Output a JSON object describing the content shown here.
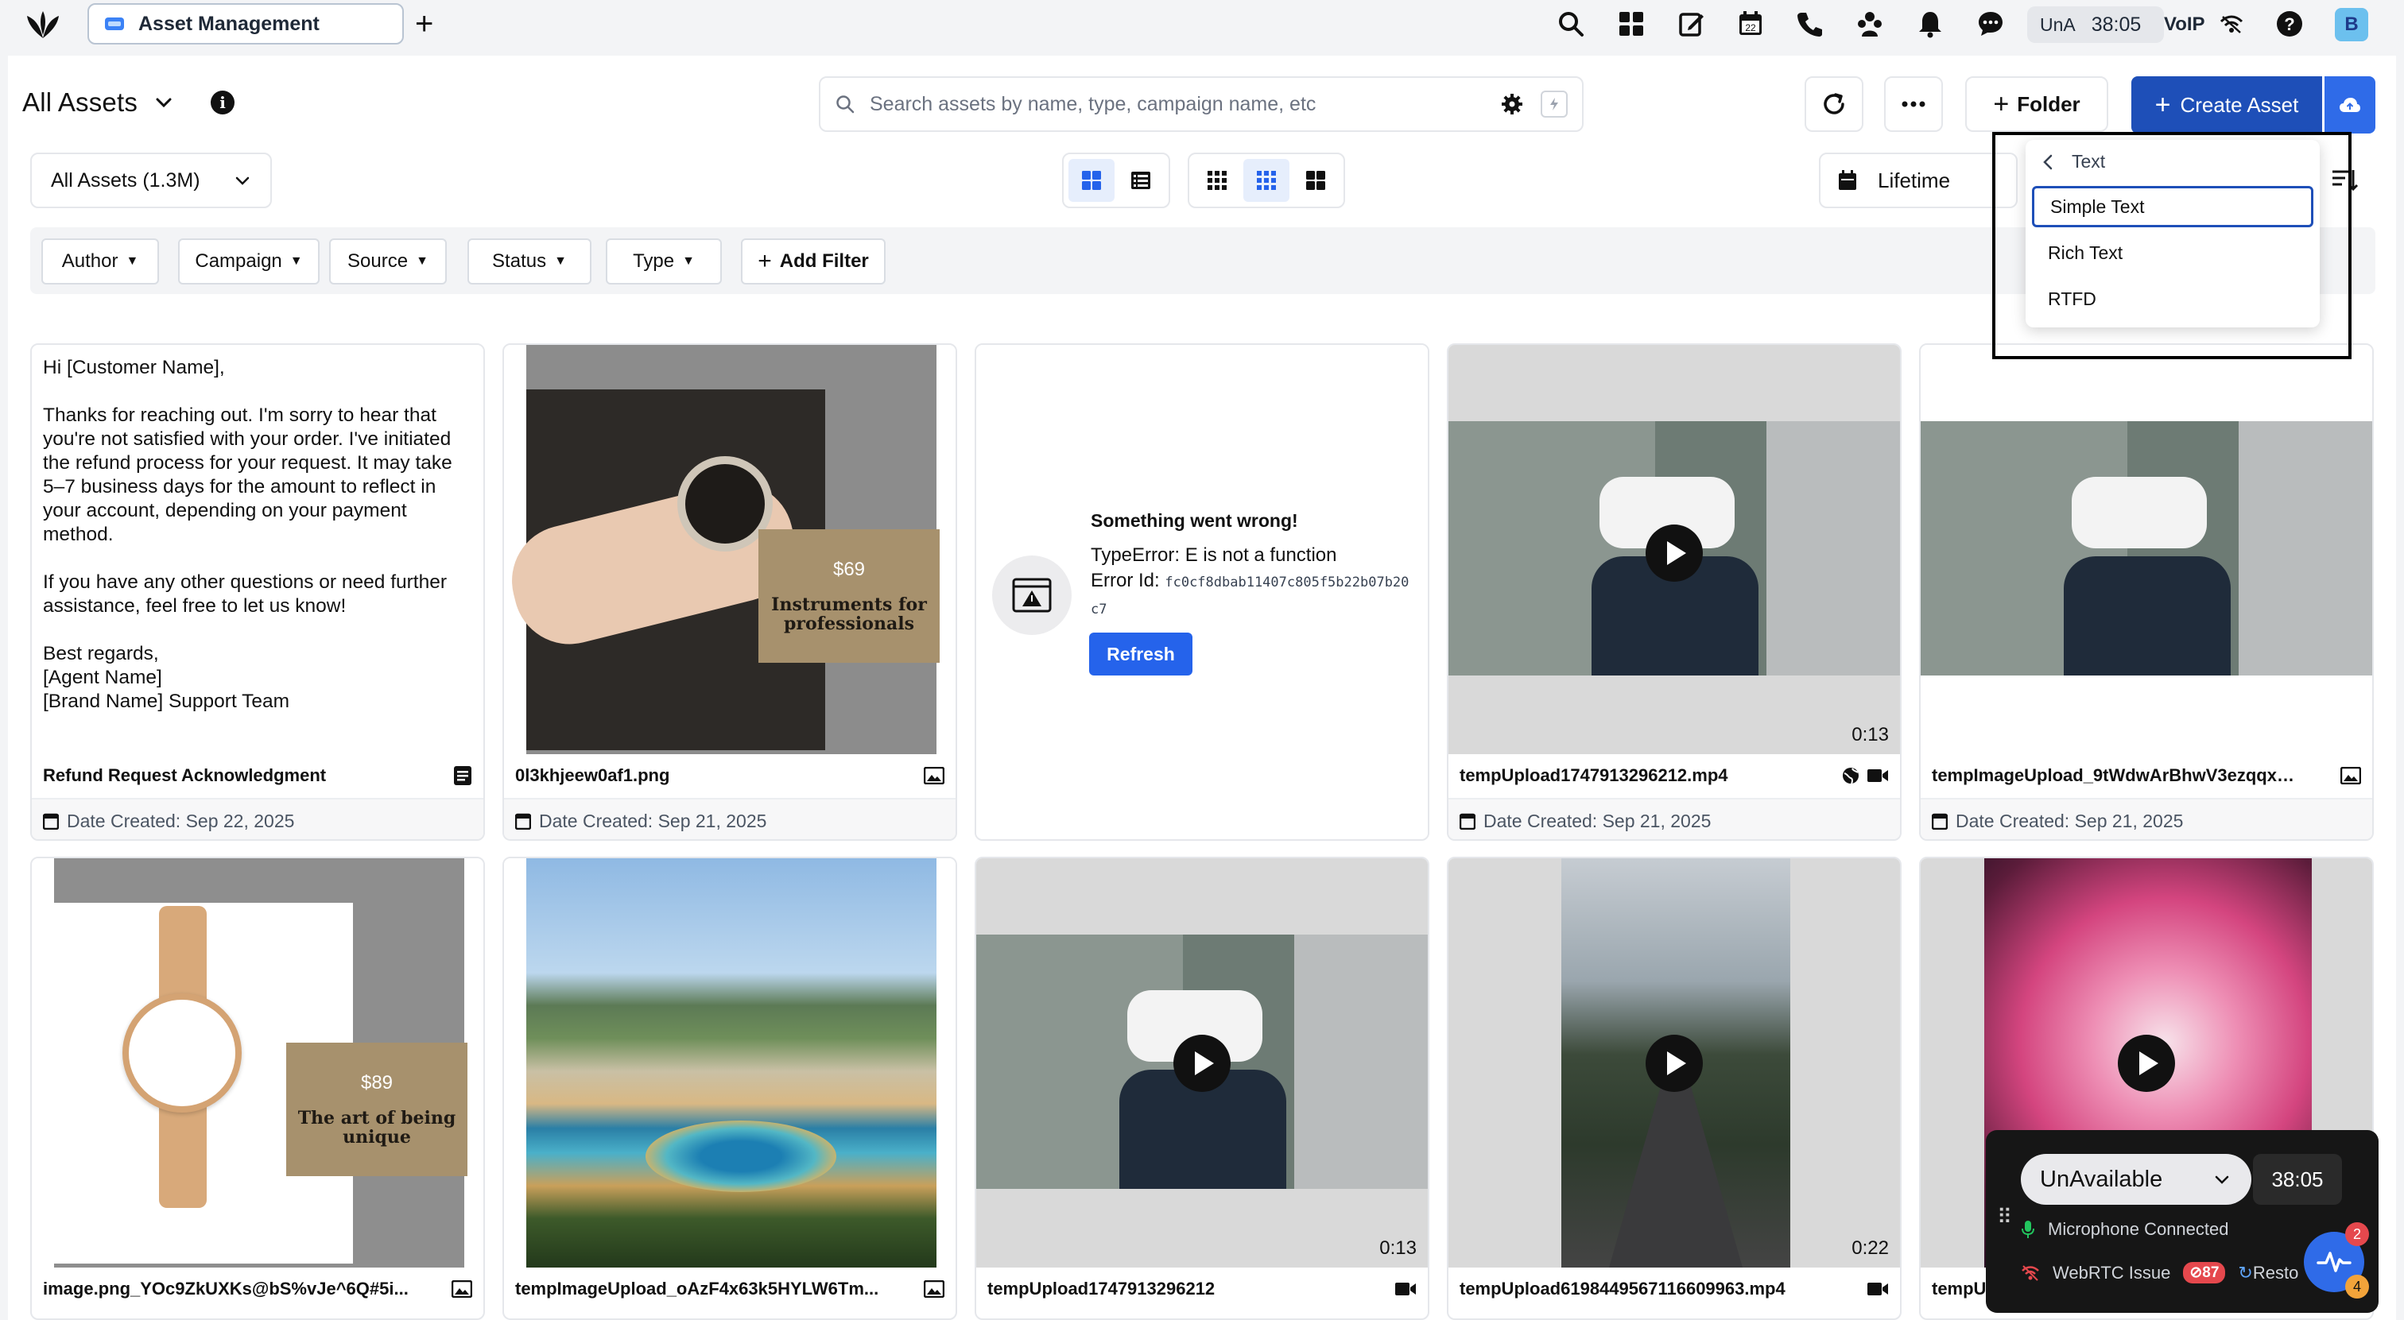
{
  "app": {
    "tab_title": "Asset Management"
  },
  "topbar": {
    "una_label": "UnA",
    "timer": "38:05",
    "voip_label": "VoIP",
    "calendar_day": "22",
    "avatar_initial": "B",
    "icons": [
      "search-icon",
      "apps-grid-icon",
      "compose-icon",
      "calendar-icon",
      "phone-icon",
      "group-icon",
      "bell-icon",
      "chat-icon",
      "wifi-icon",
      "help-icon"
    ]
  },
  "header": {
    "title": "All Assets",
    "search_placeholder": "Search assets by name, type, campaign name, etc",
    "folder_label": "Folder",
    "create_label": "Create Asset"
  },
  "filters": {
    "scope": "All Assets (1.3M)",
    "date_range": "Lifetime",
    "chips": [
      "Author",
      "Campaign",
      "Source",
      "Status",
      "Type"
    ],
    "add_filter": "Add Filter"
  },
  "dropdown": {
    "back_label": "Text",
    "items": [
      "Simple Text",
      "Rich Text",
      "RTFD"
    ],
    "selected": "Simple Text"
  },
  "cards": [
    {
      "kind": "text",
      "body": "Hi [Customer Name],\n\nThanks for reaching out. I'm sorry to hear that you're not satisfied with your order. I've initiated the refund process for your request. It may take 5–7 business days for the amount to reflect in your account, depending on your payment method.\n\nIf you have any other questions or need further assistance, feel free to let us know!\n\nBest regards,\n[Agent Name]\n[Brand Name] Support Team",
      "name": "Refund Request Acknowledgment",
      "date": "Date Created: Sep 22, 2025"
    },
    {
      "kind": "image",
      "price": "$69",
      "tagline": "Instruments for professionals",
      "name": "0l3khjeew0af1.png",
      "date": "Date Created: Sep 21, 2025"
    },
    {
      "kind": "error",
      "title": "Something went wrong!",
      "message": "TypeError: E is not a function",
      "error_label": "Error Id:",
      "error_id": "fc0cf8dbab11407c805f5b22b07b20c7",
      "button": "Refresh"
    },
    {
      "kind": "video",
      "duration": "0:13",
      "name": "tempUpload1747913296212.mp4",
      "date": "Date Created: Sep 21, 2025"
    },
    {
      "kind": "image",
      "name": "tempImageUpload_9tWdwArBhwV3ezqqxS...",
      "date": "Date Created: Sep 21, 2025"
    },
    {
      "kind": "image",
      "price": "$89",
      "tagline": "The art of being unique",
      "name": "image.png_YOc9ZkUXKs@bS%vJe^6Q#5i..."
    },
    {
      "kind": "image",
      "name": "tempImageUpload_oAzF4x63k5HYLW6Tm..."
    },
    {
      "kind": "video",
      "duration": "0:13",
      "name": "tempUpload1747913296212"
    },
    {
      "kind": "video",
      "duration": "0:22",
      "name": "tempUpload6198449567116609963.mp4"
    },
    {
      "kind": "video",
      "name": "tempU..."
    }
  ],
  "voip_widget": {
    "status": "UnAvailable",
    "timer": "38:05",
    "mic_status": "Microphone Connected",
    "webrtc_label": "WebRTC Issue",
    "webrtc_count": "87",
    "restore_label": "Resto",
    "badge_top": "2",
    "badge_bottom": "4"
  },
  "colors": {
    "primary": "#1e4fb8",
    "accent": "#2f6be8",
    "danger": "#e5484d"
  }
}
